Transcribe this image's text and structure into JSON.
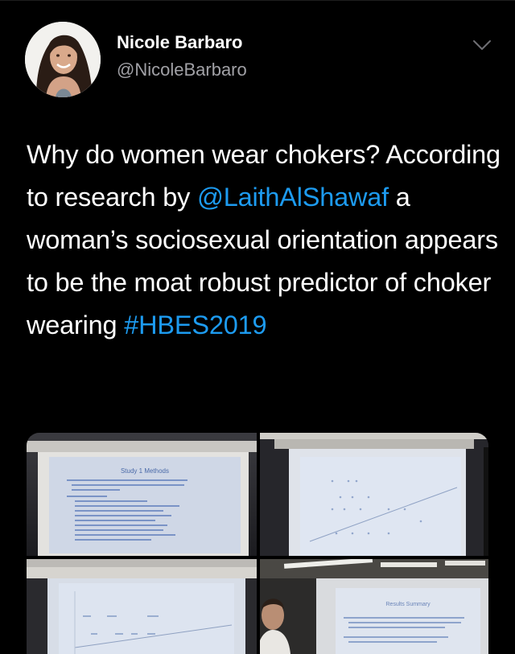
{
  "author": {
    "name": "Nicole Barbaro",
    "handle": "@NicoleBarbaro"
  },
  "tweet": {
    "text_1": "Why do women wear chokers? According to research by ",
    "mention": "@LaithAlShawaf",
    "text_2": " a woman’s sociosexual orientation appears to be the moat robust predictor of choker wearing ",
    "hashtag": "#HBES2019"
  },
  "photos": {
    "slide1_title": "Study 1 Methods",
    "slide4_title": "Results Summary"
  },
  "colors": {
    "link": "#1d9bf0",
    "background": "#000000",
    "secondary_text": "#a1a1a6"
  },
  "icons": [
    "chevron-down-icon"
  ]
}
